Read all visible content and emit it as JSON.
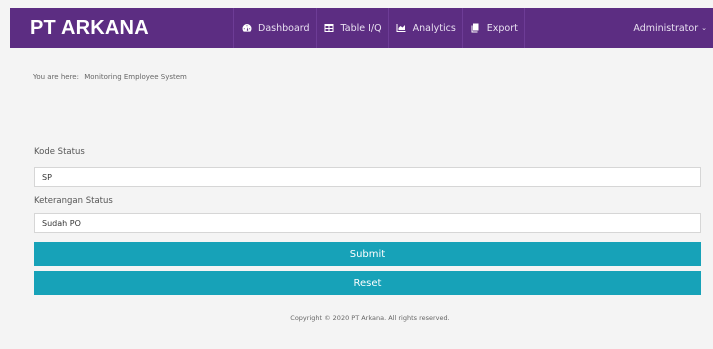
{
  "navbar": {
    "brand": "PT ARKANA",
    "items": [
      {
        "label": "Dashboard",
        "icon": "dashboard-icon"
      },
      {
        "label": "Table I/Q",
        "icon": "table-icon"
      },
      {
        "label": "Analytics",
        "icon": "area-chart-icon"
      },
      {
        "label": "Export",
        "icon": "copy-icon"
      }
    ],
    "user": "Administrator",
    "user_caret": "⌄",
    "bg_color": "#5c2d82"
  },
  "breadcrumb": {
    "prefix": "You are here:",
    "current": "Monitoring Employee System"
  },
  "form": {
    "kode_label": "Kode Status",
    "kode_value": "SP",
    "keterangan_label": "Keterangan Status",
    "keterangan_value": "Sudah PO",
    "submit_label": "Submit",
    "reset_label": "Reset",
    "button_color": "#17a2b8"
  },
  "footer": {
    "text": "Copyright © 2020 PT Arkana. All rights reserved."
  }
}
